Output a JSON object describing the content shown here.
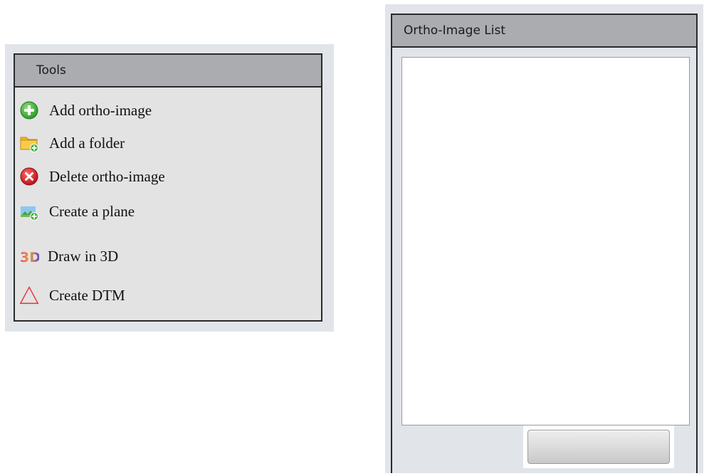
{
  "tools_panel": {
    "title": "Tools",
    "items": [
      {
        "label": "Add ortho-image",
        "icon": "add-circle-icon"
      },
      {
        "label": "Add a folder",
        "icon": "add-folder-icon"
      },
      {
        "label": "Delete ortho-image",
        "icon": "delete-circle-icon"
      },
      {
        "label": "Create a plane",
        "icon": "add-plane-icon"
      },
      {
        "label": "Draw in 3D",
        "icon": "draw-3d-icon",
        "icon_text": "3D"
      },
      {
        "label": "Create DTM",
        "icon": "triangle-icon"
      }
    ]
  },
  "list_panel": {
    "title": "Ortho-Image List",
    "button_label": ""
  },
  "colors": {
    "header_bg": "#aaacaf",
    "panel_bg": "#e3e3e3",
    "frame_bg": "#e1e5ea",
    "border": "#2a2a2a",
    "add_green": "#3fb13a",
    "delete_red": "#d9262c",
    "triangle_red": "#e8323c"
  }
}
